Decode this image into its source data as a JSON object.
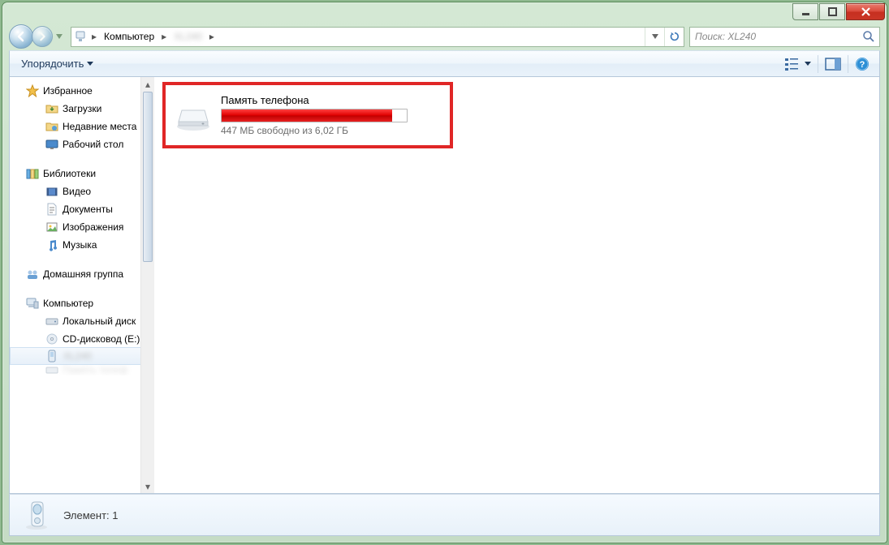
{
  "breadcrumb": {
    "root": "Компьютер"
  },
  "search": {
    "placeholder": "Поиск: XL240"
  },
  "toolbar": {
    "organize": "Упорядочить"
  },
  "sidebar": {
    "favorites": "Избранное",
    "downloads": "Загрузки",
    "recent": "Недавние места",
    "desktop": "Рабочий стол",
    "libraries": "Библиотеки",
    "video": "Видео",
    "documents": "Документы",
    "pictures": "Изображения",
    "music": "Музыка",
    "homegroup": "Домашняя группа",
    "computer": "Компьютер",
    "localdisk": "Локальный диск",
    "cddrive": "CD-дисковод (E:)"
  },
  "drive": {
    "name": "Память телефона",
    "status": "447 МБ свободно из 6,02 ГБ"
  },
  "statusbar": {
    "text": "Элемент: 1"
  }
}
